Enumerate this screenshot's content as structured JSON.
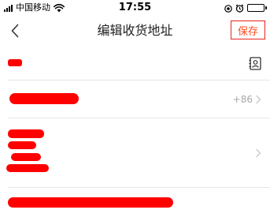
{
  "status_bar": {
    "carrier": "中国移动",
    "time": "17:55",
    "icons": [
      "signal-icon",
      "wifi-icon",
      "location-icon",
      "alarm-icon",
      "battery-icon"
    ]
  },
  "nav": {
    "back_icon": "chevron-left-icon",
    "title": "编辑收货地址",
    "save_label": "保存"
  },
  "form": {
    "name_row": {
      "value": "[redacted]",
      "trailing_icon": "contacts-icon"
    },
    "phone_row": {
      "value": "[redacted]",
      "prefix": "+86",
      "trailing_icon": "chevron-right-icon"
    },
    "region_row": {
      "value": "[redacted]",
      "trailing_icon": "chevron-right-icon"
    },
    "detail_row": {
      "value": "[redacted]"
    }
  },
  "colors": {
    "accent": "#ff4a1f",
    "highlight_border": "#e8231c",
    "redaction": "#ff0000",
    "divider": "#e6e6e6",
    "muted_text": "#a8a8a8"
  }
}
